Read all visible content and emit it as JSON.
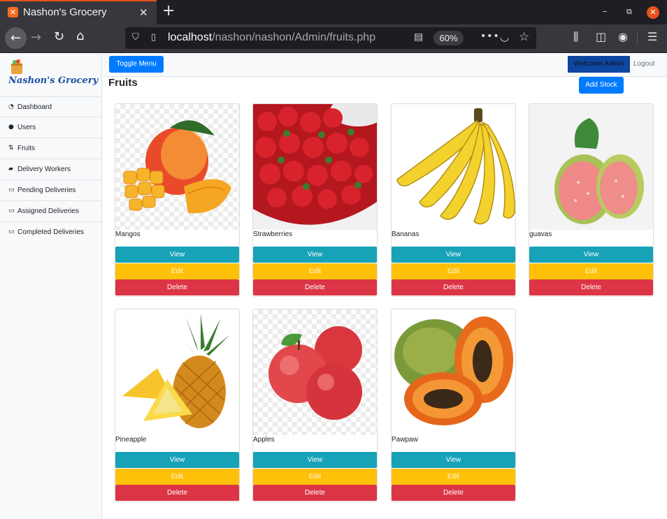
{
  "browser": {
    "tab_title": "Nashon's Grocery",
    "new_tab_symbol": "+",
    "url_host": "localhost",
    "url_path": "/nashon/nashon/Admin/fruits.php",
    "zoom": "60%"
  },
  "sidebar": {
    "brand": "Nashon's Grocery",
    "items": [
      {
        "label": "Dashboard",
        "icon": "dashboard-icon"
      },
      {
        "label": "Users",
        "icon": "user-icon"
      },
      {
        "label": "Fruits",
        "icon": "fruits-icon"
      },
      {
        "label": "Delivery Workers",
        "icon": "truck-icon"
      },
      {
        "label": "Pending Deliveries",
        "icon": "card-icon"
      },
      {
        "label": "Assigned Deliveries",
        "icon": "card-icon"
      },
      {
        "label": "Completed Deliveries",
        "icon": "card-icon"
      }
    ]
  },
  "topbar": {
    "toggle_label": "Toggle Menu",
    "welcome_label": "Welcome Admin",
    "logout_label": "Logout"
  },
  "main": {
    "title": "Fruits",
    "add_stock_label": "Add Stock",
    "button_labels": {
      "view": "View",
      "edit": "Edit",
      "delete": "Delete"
    },
    "products": [
      {
        "name": "Mangos"
      },
      {
        "name": "Strawberries"
      },
      {
        "name": "Bananas"
      },
      {
        "name": "guavas"
      },
      {
        "name": "Pineapple"
      },
      {
        "name": "Apples"
      },
      {
        "name": "Pawpaw"
      }
    ]
  },
  "colors": {
    "primary": "#007bff",
    "info": "#17a2b8",
    "warning": "#ffc107",
    "danger": "#dc3545",
    "welcome_bg": "#0d47a1"
  }
}
